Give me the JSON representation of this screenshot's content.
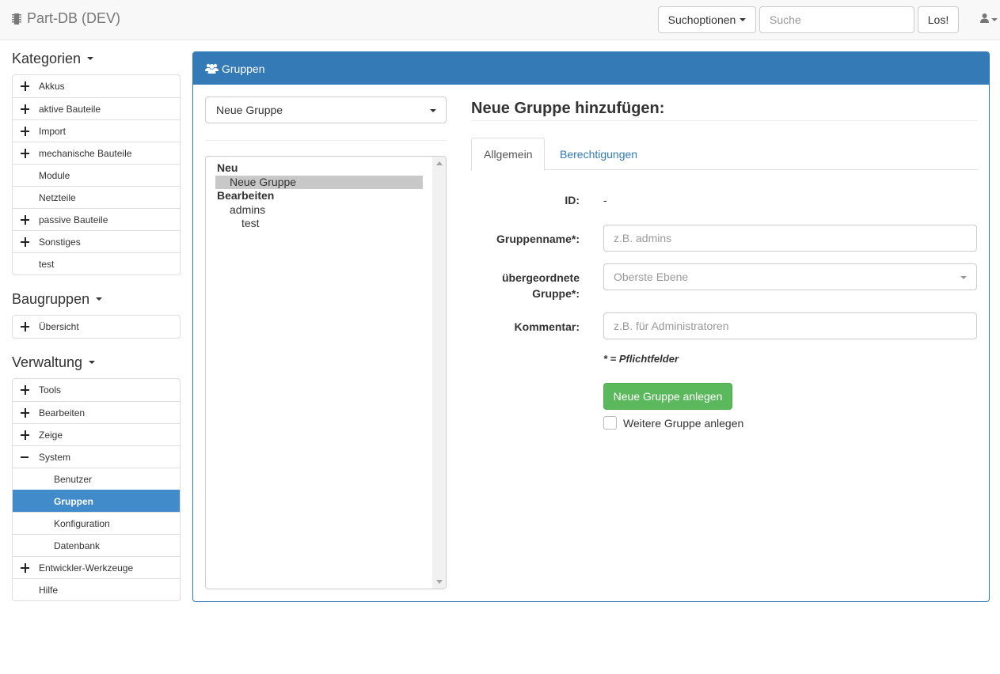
{
  "navbar": {
    "brand": "Part-DB (DEV)",
    "search_options_label": "Suchoptionen",
    "search_placeholder": "Suche",
    "search_value": "",
    "go_label": "Los!"
  },
  "sidebar": {
    "categories": {
      "heading": "Kategorien",
      "items": [
        {
          "label": "Akkus",
          "expander": "plus"
        },
        {
          "label": "aktive Bauteile",
          "expander": "plus"
        },
        {
          "label": "Import",
          "expander": "plus"
        },
        {
          "label": "mechanische Bauteile",
          "expander": "plus"
        },
        {
          "label": "Module",
          "expander": "none"
        },
        {
          "label": "Netzteile",
          "expander": "none"
        },
        {
          "label": "passive Bauteile",
          "expander": "plus"
        },
        {
          "label": "Sonstiges",
          "expander": "plus"
        },
        {
          "label": "test",
          "expander": "none"
        }
      ]
    },
    "assemblies": {
      "heading": "Baugruppen",
      "items": [
        {
          "label": "Übersicht",
          "expander": "plus"
        }
      ]
    },
    "admin": {
      "heading": "Verwaltung",
      "items": [
        {
          "label": "Tools",
          "expander": "plus"
        },
        {
          "label": "Bearbeiten",
          "expander": "plus"
        },
        {
          "label": "Zeige",
          "expander": "plus"
        },
        {
          "label": "System",
          "expander": "minus"
        },
        {
          "label": "Benutzer",
          "child": true
        },
        {
          "label": "Gruppen",
          "child": true,
          "active": true
        },
        {
          "label": "Konfiguration",
          "child": true
        },
        {
          "label": "Datenbank",
          "child": true
        },
        {
          "label": "Entwickler-Werkzeuge",
          "expander": "plus"
        },
        {
          "label": "Hilfe",
          "expander": "none"
        }
      ]
    }
  },
  "panel": {
    "title": "Gruppen",
    "group_select_value": "Neue Gruppe",
    "tree": {
      "new_heading": "Neu",
      "new_group": "Neue Gruppe",
      "edit_heading": "Bearbeiten",
      "admins": "admins",
      "test": "test"
    },
    "form": {
      "title": "Neue Gruppe hinzufügen:",
      "tab_general": "Allgemein",
      "tab_permissions": "Berechtigungen",
      "id_label": "ID:",
      "id_value": "-",
      "name_label": "Gruppenname*:",
      "name_placeholder": "z.B. admins",
      "parent_label_line1": "übergeordnete",
      "parent_label_line2": "Gruppe*:",
      "parent_value": "Oberste Ebene",
      "comment_label": "Kommentar:",
      "comment_placeholder": "z.B. für Administratoren",
      "required_note": "* = Pflichtfelder",
      "submit_label": "Neue Gruppe anlegen",
      "another_label": "Weitere Gruppe anlegen",
      "another_checked": false
    }
  },
  "colors": {
    "primary": "#337ab7",
    "active_item": "#428bca",
    "success": "#5cb85c"
  }
}
